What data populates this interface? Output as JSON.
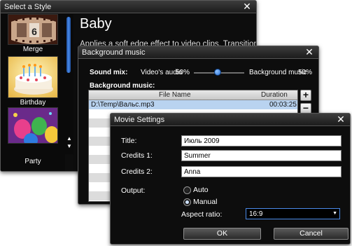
{
  "style_window": {
    "title": "Select a Style",
    "styles": [
      {
        "label": "Merge"
      },
      {
        "label": "Birthday"
      },
      {
        "label": "Party"
      }
    ],
    "merge_thumb_number": "6",
    "selected_style_name": "Baby",
    "description": "Applies a soft edge effect to video clips. Transitions are"
  },
  "music_window": {
    "title": "Background music",
    "sound_mix_label": "Sound mix:",
    "videos_audio_label": "Video's audio",
    "videos_audio_value": "50%",
    "background_music_mix_label": "Background music",
    "background_music_value": "50%",
    "mix_position_percent": 50,
    "background_music_label": "Background music:",
    "table": {
      "columns": [
        "File Name",
        "Duration"
      ],
      "rows": [
        {
          "file": "D:\\Temp\\Вальс.mp3",
          "duration": "00:03:25"
        }
      ]
    },
    "add_label": "+",
    "remove_label": "−"
  },
  "movie_settings": {
    "title": "Movie Settings",
    "title_label": "Title:",
    "title_value": "Июль 2009",
    "credits1_label": "Credits 1:",
    "credits1_value": "Summer",
    "credits2_label": "Credits 2:",
    "credits2_value": "Anna",
    "output_label": "Output:",
    "output_options": [
      "Auto",
      "Manual"
    ],
    "output_selected": "Manual",
    "aspect_ratio_label": "Aspect ratio:",
    "aspect_ratio_value": "16:9",
    "ok_label": "OK",
    "cancel_label": "Cancel"
  },
  "colors": {
    "window_bg": "#0d0d0d",
    "accent_blue": "#4a8ae8",
    "selected_row": "#b9d3f0"
  },
  "icons": {
    "close": "close-icon",
    "dropdown": "chevron-down-icon",
    "scroll_up": "arrow-up-icon",
    "scroll_down": "arrow-down-icon"
  }
}
